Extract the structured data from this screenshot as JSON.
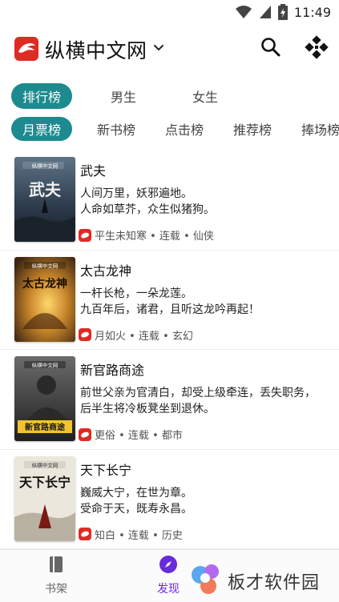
{
  "status_bar": {
    "time": "11:49"
  },
  "app_bar": {
    "title": "纵横中文网"
  },
  "main_tabs": [
    {
      "label": "排行榜",
      "active": true
    },
    {
      "label": "男生",
      "active": false
    },
    {
      "label": "女生",
      "active": false
    }
  ],
  "sub_tabs": [
    {
      "label": "月票榜",
      "active": true
    },
    {
      "label": "新书榜",
      "active": false
    },
    {
      "label": "点击榜",
      "active": false
    },
    {
      "label": "推荐榜",
      "active": false
    },
    {
      "label": "捧场榜",
      "active": false
    }
  ],
  "books": [
    {
      "title": "武夫",
      "desc_line1": "人间万里，妖邪遍地。",
      "desc_line2": "人命如草芥，众生似猪狗。",
      "meta": "平生未知寒 • 连载 • 仙侠",
      "cover_text": "武夫",
      "cover_color": "#2c3a4a"
    },
    {
      "title": "太古龙神",
      "desc_line1": "一杆长枪，一朵龙莲。",
      "desc_line2": "九百年后，诸君，且听这龙吟再起！",
      "meta": "月如火 • 连载 • 玄幻",
      "cover_text": "太古龙神",
      "cover_color": "#8a5a1e"
    },
    {
      "title": "新官路商途",
      "desc_line1": "前世父亲为官清白，却受上级牵连，丢失职务，后半生将冷板凳坐到退休。",
      "desc_line2": "",
      "meta": "更俗 • 连载 • 都市",
      "cover_text": "新官路商途",
      "cover_color": "#3a3a3a"
    },
    {
      "title": "天下长宁",
      "desc_line1": "巍威大宁，在世为章。",
      "desc_line2": "受命于天，既寿永昌。",
      "meta": "知白 • 连载 • 历史",
      "cover_text": "天下长宁",
      "cover_color": "#e8e2d6"
    }
  ],
  "cover_badge": "纵横中文网",
  "bottom_nav": [
    {
      "label": "书架",
      "icon": "bookshelf-icon",
      "active": false
    },
    {
      "label": "发现",
      "icon": "compass-icon",
      "active": true
    }
  ],
  "watermark": {
    "text": "板才软件园"
  },
  "colors": {
    "accent": "#1c8a8e",
    "brand_red": "#e02a24",
    "nav_active": "#6a2bd9"
  }
}
